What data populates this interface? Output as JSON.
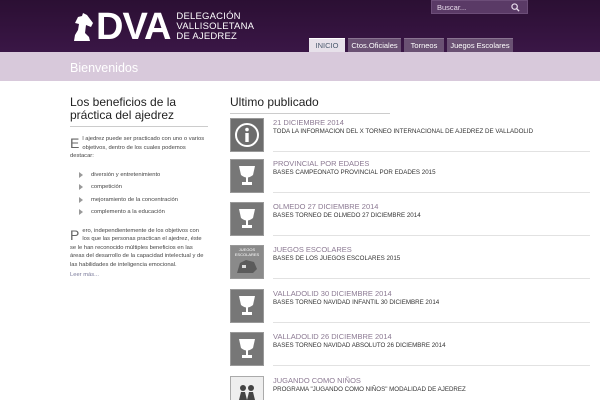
{
  "header": {
    "logo_letters": "DVA",
    "logo_text": [
      "DELEGACIÓN",
      "VALLISOLETANA",
      "DE AJEDREZ"
    ],
    "search_placeholder": "Buscar..."
  },
  "nav": {
    "tabs": [
      {
        "label": "INICIO",
        "active": true
      },
      {
        "label": "Ctos.Oficiales",
        "active": false
      },
      {
        "label": "Torneos",
        "active": false
      },
      {
        "label": "Juegos Escolares",
        "active": false
      }
    ]
  },
  "band": {
    "title": "Bienvenidos"
  },
  "left": {
    "heading": "Los beneficios de la práctica del ajedrez",
    "p1_dropcap": "E",
    "p1_text": "l ajedrez puede ser practicado con uno o varios objetivos, dentro de los cuales podemos destacar:",
    "benefits": [
      "diversión y entretenimiento",
      "competición",
      "mejoramiento de la concentración",
      "complemento a la educación"
    ],
    "p2_dropcap": "P",
    "p2_text": "ero, independientemente de los objetivos con los que las personas practican el ajedrez, éste se le han reconocido múltiples beneficios en las áreas del desarrollo de la capacidad intelectual y de las habilidades de inteligencia emocional.",
    "read_more": "Leer más..."
  },
  "right": {
    "heading": "Ultimo publicado",
    "posts": [
      {
        "category": "21 DICIEMBRE 2014",
        "title": "TODA LA INFORMACION DEL X TORNEO INTERNACIONAL DE AJEDREZ DE VALLADOLID",
        "icon": "info-icon"
      },
      {
        "category": "PROVINCIAL POR EDADES",
        "title": "BASES CAMPEONATO PROVINCIAL POR EDADES 2015",
        "icon": "trophy-icon"
      },
      {
        "category": "OLMEDO 27 DICIEMBRE 2014",
        "title": "BASES TORNEO DE OLMEDO 27 DICIEMBRE 2014",
        "icon": "trophy-icon"
      },
      {
        "category": "JUEGOS ESCOLARES",
        "title": "BASES DE LOS JUEGOS ESCOLARES 2015",
        "icon": "juegos-escolares-icon",
        "thumb_text": "JUEGOS ESCOLARES"
      },
      {
        "category": "VALLADOLID 30 DICIEMBRE 2014",
        "title": "BASES TORNEO NAVIDAD INFANTIL 30 DICIEMBRE 2014",
        "icon": "trophy-icon"
      },
      {
        "category": "VALLADOLID 26 DICIEMBRE 2014",
        "title": "BASES TORNEO NAVIDAD ABSOLUTO 26 DICIEMBRE 2014",
        "icon": "trophy-icon"
      },
      {
        "category": "JUGANDO COMO NIÑOS",
        "title": "PROGRAMA \"JUGANDO COMO NIÑOS\" MODALIDAD DE AJEDREZ",
        "icon": "children-icon"
      }
    ]
  },
  "colors": {
    "header_bg": "#2b0f33",
    "band_bg": "#d8c9db",
    "accent": "#8c7a93"
  }
}
